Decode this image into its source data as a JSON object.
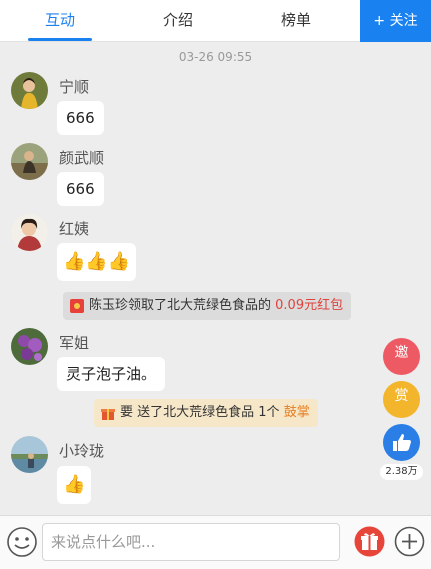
{
  "tabs": [
    {
      "label": "互动",
      "active": true
    },
    {
      "label": "介绍",
      "active": false
    },
    {
      "label": "榜单",
      "active": false
    }
  ],
  "follow_button": "+ 关注",
  "timestamp": "03-26 09:55",
  "messages": [
    {
      "user": "宁顺",
      "text": "666"
    },
    {
      "user": "颜武顺",
      "text": "666"
    },
    {
      "user": "红姨",
      "text": "👍👍👍"
    },
    {
      "user": "军姐",
      "text": "灵子泡子油。"
    },
    {
      "user": "小玲珑",
      "text": "👍"
    }
  ],
  "notices": {
    "redpacket": {
      "text": "陈玉珍领取了北大荒绿色食品的",
      "amount": "0.09元红包"
    },
    "gift": {
      "text": "要 送了北大荒绿色食品 1个",
      "gift": "鼓掌"
    }
  },
  "side_buttons": {
    "invite": "邀",
    "reward": "赏",
    "likes": "2.38万"
  },
  "input": {
    "placeholder": "来说点什么吧..."
  },
  "colors": {
    "accent": "#1a82f0",
    "invite": "#ee5a64",
    "reward": "#f3b52b",
    "like": "#2a7ee6"
  }
}
